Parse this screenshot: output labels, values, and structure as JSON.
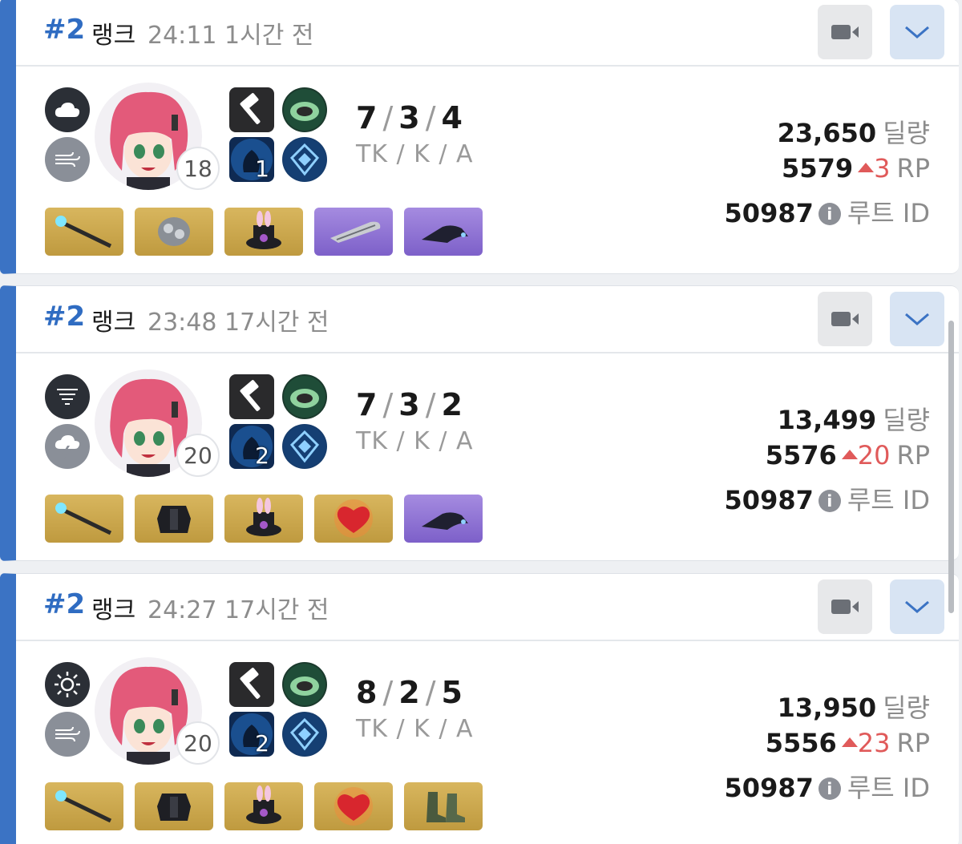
{
  "matches": [
    {
      "rank": "#2",
      "mode": "랭크",
      "duration": "24:11",
      "ago": "1시간 전",
      "weather": [
        "cloud-icon",
        "wind-icon"
      ],
      "level": "18",
      "skill_level": "1",
      "kda": {
        "k": "7",
        "d": "3",
        "a": "4"
      },
      "kda_label": "TK / K / A",
      "damage": "23,650",
      "damage_label": "딜량",
      "rp": "5579",
      "rp_delta": "3",
      "rp_label": "RP",
      "root_id": "50987",
      "root_label": "루트 ID",
      "items": [
        "gold",
        "gold",
        "gold",
        "purple",
        "purple"
      ]
    },
    {
      "rank": "#2",
      "mode": "랭크",
      "duration": "23:48",
      "ago": "17시간 전",
      "weather": [
        "fog-icon",
        "thunderstorm-icon"
      ],
      "level": "20",
      "skill_level": "2",
      "kda": {
        "k": "7",
        "d": "3",
        "a": "2"
      },
      "kda_label": "TK / K / A",
      "damage": "13,499",
      "damage_label": "딜량",
      "rp": "5576",
      "rp_delta": "20",
      "rp_label": "RP",
      "root_id": "50987",
      "root_label": "루트 ID",
      "items": [
        "gold",
        "gold",
        "gold",
        "gold",
        "purple"
      ]
    },
    {
      "rank": "#2",
      "mode": "랭크",
      "duration": "24:27",
      "ago": "17시간 전",
      "weather": [
        "sun-icon",
        "wind-icon"
      ],
      "level": "20",
      "skill_level": "2",
      "kda": {
        "k": "8",
        "d": "2",
        "a": "5"
      },
      "kda_label": "TK / K / A",
      "damage": "13,950",
      "damage_label": "딜량",
      "rp": "5556",
      "rp_delta": "23",
      "rp_label": "RP",
      "root_id": "50987",
      "root_label": "루트 ID",
      "items": [
        "gold",
        "gold",
        "gold",
        "gold",
        "gold"
      ]
    }
  ],
  "colors": {
    "accent": "#3b73c4",
    "rank": "#2f6cc2",
    "rp_up": "#e05a5a"
  }
}
